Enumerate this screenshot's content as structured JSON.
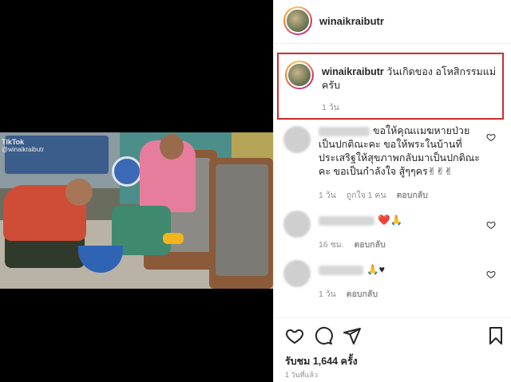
{
  "post": {
    "username": "winaikraibutr",
    "caption_user": "winaikraibutr",
    "caption_text": "วันเกิดของ อโหสิกรรมแม่ครับ",
    "caption_time": "1 วัน",
    "video_watermark_brand": "TikTok",
    "video_watermark_user": "@winaikraibutr"
  },
  "comments": [
    {
      "text": "ขอให้คุณเเมฆหายป่วย เป็นปกติณะคะ ขอให้พระในบ้านที่ประเสริฐให้สุขภาพกลับมาเป็นปกติณะคะ ขอเป็นกำลังใจ สู้ๆๆคร✌✌✌",
      "time": "1 วัน",
      "likes": "ถูกใจ 1 คน",
      "reply": "ตอบกลับ"
    },
    {
      "text": "❤️🙏",
      "time": "16 ชม.",
      "reply": "ตอบกลับ"
    },
    {
      "text": "🙏♥",
      "time": "1 วัน",
      "reply": "ตอบกลับ"
    }
  ],
  "footer": {
    "likes_text": "รับชม 1,644 ครั้ง",
    "posted_ago": "1 วันที่แล้ว"
  },
  "colors": {
    "highlight_border": "#d22a2a",
    "muted_text": "#8e8e8e"
  },
  "icons": [
    "heart-icon",
    "comment-icon",
    "share-icon",
    "bookmark-icon"
  ]
}
